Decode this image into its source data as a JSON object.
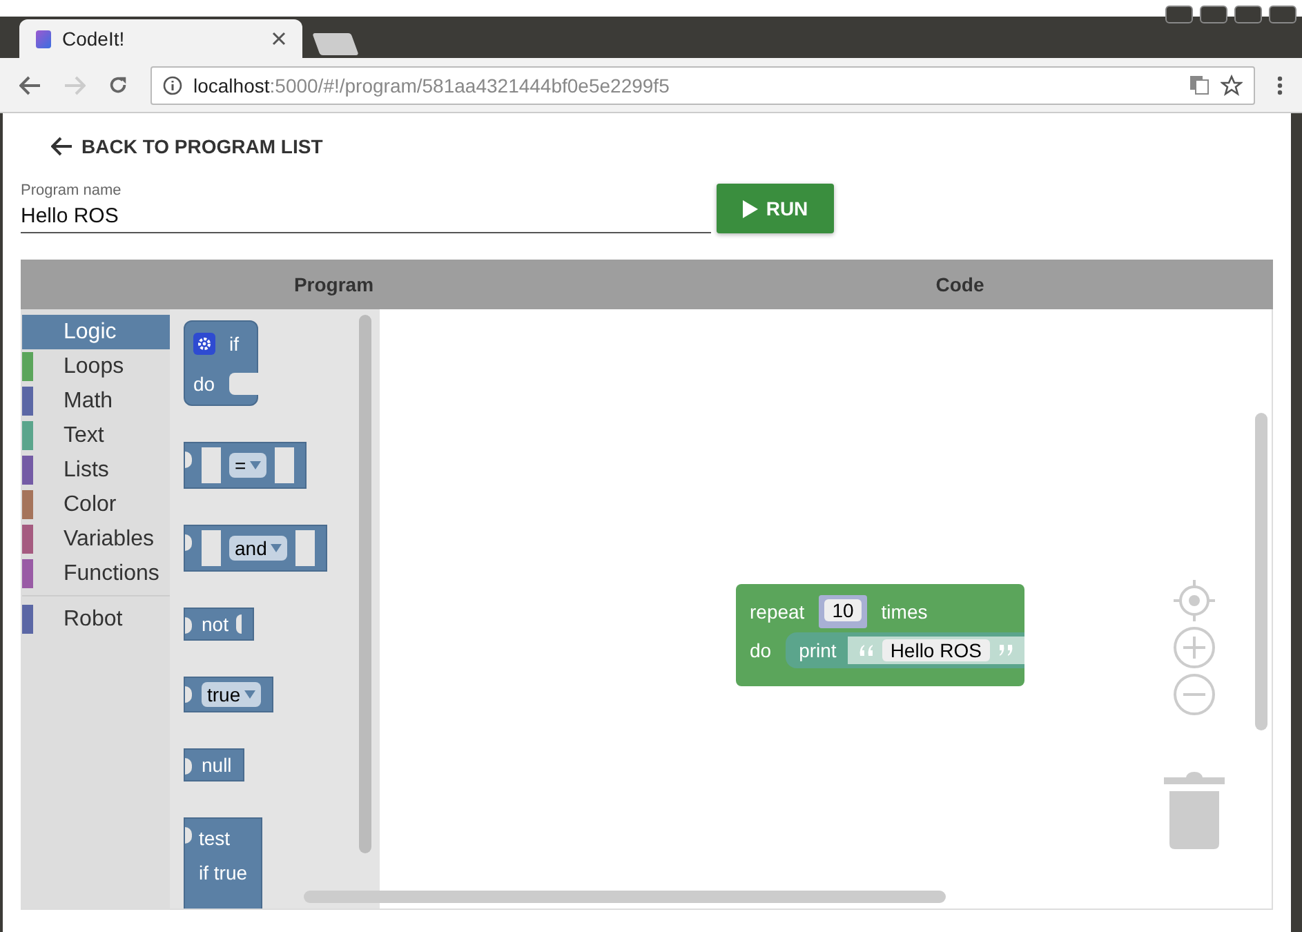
{
  "browser": {
    "tab_title": "CodeIt!",
    "url_host": "localhost",
    "url_path": ":5000/#!/program/581aa4321444bf0e5e2299f5"
  },
  "back_link": "BACK TO PROGRAM LIST",
  "program_name": {
    "label": "Program name",
    "value": "Hello ROS"
  },
  "run_button": "RUN",
  "panes": [
    {
      "label": "Program"
    },
    {
      "label": "Code"
    }
  ],
  "toolbox": [
    {
      "label": "Logic",
      "color": "#5b80a5",
      "selected": true
    },
    {
      "label": "Loops",
      "color": "#5ba55b",
      "selected": false
    },
    {
      "label": "Math",
      "color": "#5b67a5",
      "selected": false
    },
    {
      "label": "Text",
      "color": "#5ba58c",
      "selected": false
    },
    {
      "label": "Lists",
      "color": "#745ba5",
      "selected": false
    },
    {
      "label": "Color",
      "color": "#a5745b",
      "selected": false
    },
    {
      "label": "Variables",
      "color": "#a55b80",
      "selected": false
    },
    {
      "label": "Functions",
      "color": "#995ba5",
      "selected": false
    },
    {
      "label": "Robot",
      "color": "#5b67a5",
      "selected": false,
      "separated": true
    }
  ],
  "flyout": [
    {
      "kind": "if",
      "texts": [
        "if",
        "do"
      ]
    },
    {
      "kind": "compare",
      "texts": [
        "="
      ]
    },
    {
      "kind": "compare",
      "texts": [
        "and"
      ]
    },
    {
      "kind": "plain",
      "texts": [
        "not"
      ]
    },
    {
      "kind": "dropdown",
      "texts": [
        "true"
      ]
    },
    {
      "kind": "value",
      "texts": [
        "null"
      ]
    },
    {
      "kind": "ternary",
      "texts": [
        "test",
        "if true"
      ]
    }
  ],
  "program": {
    "repeat": "repeat",
    "count": "10",
    "times": "times",
    "do": "do",
    "print": "print",
    "string": "Hello ROS"
  }
}
